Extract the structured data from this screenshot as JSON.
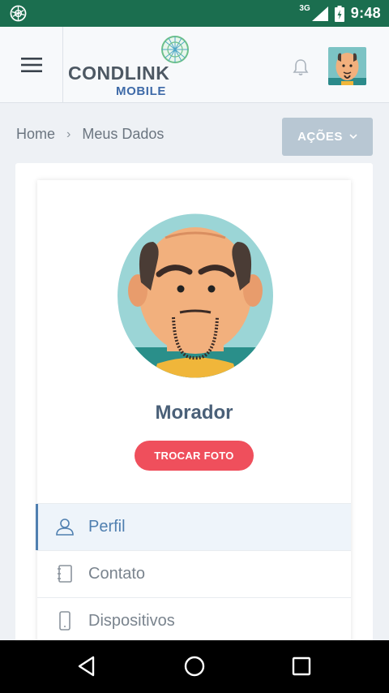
{
  "status_bar": {
    "network": "3G",
    "time": "9:48"
  },
  "header": {
    "logo_title": "CONDLINK",
    "logo_sub": "MOBILE"
  },
  "breadcrumb": {
    "home": "Home",
    "current": "Meus Dados"
  },
  "actions_button": {
    "label": "AÇÕES"
  },
  "profile": {
    "name": "Morador",
    "change_photo_label": "TROCAR FOTO"
  },
  "menu": [
    {
      "label": "Perfil",
      "icon": "user-icon",
      "active": true
    },
    {
      "label": "Contato",
      "icon": "address-book-icon",
      "active": false
    },
    {
      "label": "Dispositivos",
      "icon": "mobile-device-icon",
      "active": false
    }
  ],
  "colors": {
    "status_bar": "#1b6e4f",
    "accent_blue": "#4f7fb0",
    "actions_button": "#b8c7d3",
    "change_photo_button": "#ef4f5c"
  }
}
